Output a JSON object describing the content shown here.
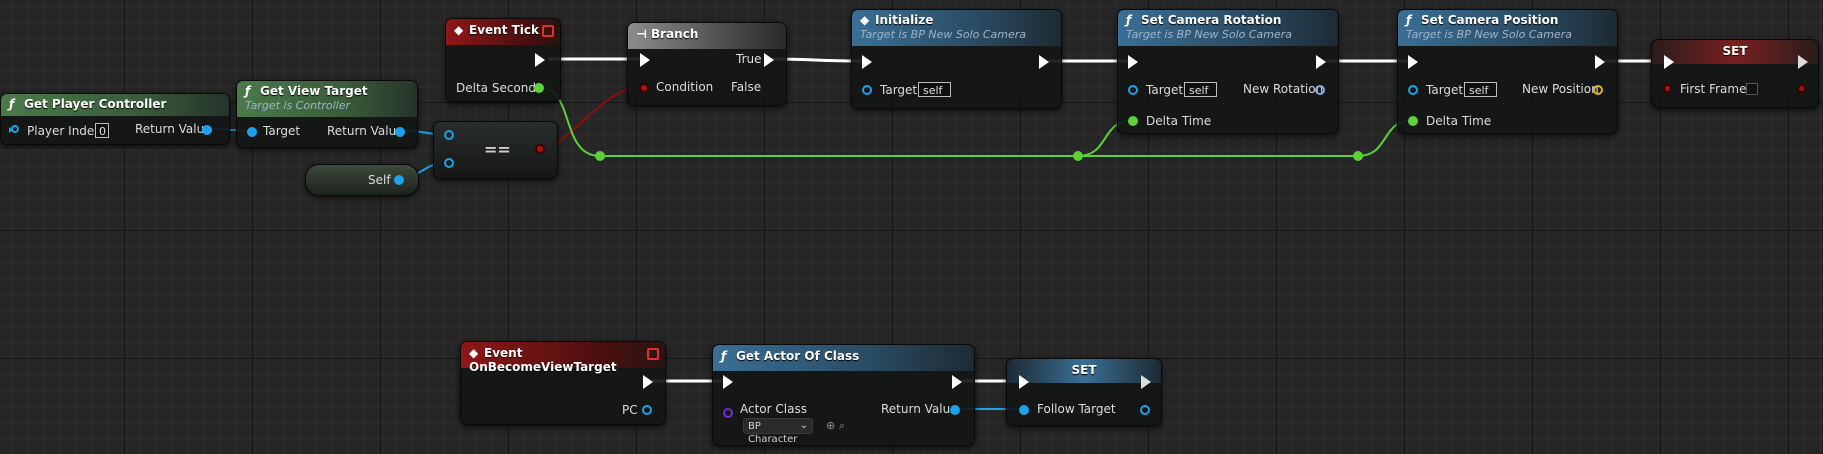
{
  "nodes": {
    "get_player_controller": {
      "title": "Get Player Controller",
      "player_index_label": "Player Index",
      "player_index_value": "0",
      "return_label": "Return Value"
    },
    "get_view_target": {
      "title": "Get View Target",
      "subtitle": "Target is Controller",
      "target_label": "Target",
      "return_label": "Return Value"
    },
    "self_node": {
      "label": "Self"
    },
    "equal_node": {
      "symbol": "=="
    },
    "event_tick": {
      "title": "Event Tick",
      "delta_label": "Delta Seconds"
    },
    "branch": {
      "title": "Branch",
      "true_label": "True",
      "false_label": "False",
      "condition_label": "Condition"
    },
    "initialize": {
      "title": "Initialize",
      "subtitle": "Target is BP New Solo Camera",
      "target_label": "Target",
      "target_value": "self"
    },
    "set_camera_rotation": {
      "title": "Set Camera Rotation",
      "subtitle": "Target is BP New Solo Camera",
      "target_label": "Target",
      "target_value": "self",
      "new_label": "New Rotation",
      "delta_label": "Delta Time"
    },
    "set_camera_position": {
      "title": "Set Camera Position",
      "subtitle": "Target is BP New Solo Camera",
      "target_label": "Target",
      "target_value": "self",
      "new_label": "New Position",
      "delta_label": "Delta Time"
    },
    "set_first_frame": {
      "title": "SET",
      "var_label": "First Frame"
    },
    "event_on_become_view_target": {
      "title": "Event OnBecomeViewTarget",
      "pc_label": "PC"
    },
    "get_actor_of_class": {
      "title": "Get Actor Of Class",
      "class_label": "Actor Class",
      "class_value": "BP Character",
      "return_label": "Return Value"
    },
    "set_follow_target": {
      "title": "SET",
      "var_label": "Follow Target"
    }
  },
  "icons": {
    "function": "function-icon",
    "event": "event-icon",
    "branch": "branch-icon"
  },
  "colors": {
    "exec": "#ffffff",
    "object_pin": "#1da2e8",
    "float_pin": "#5ed138",
    "bool_pin": "#b01010",
    "vector_pin": "#e0b21a",
    "class_pin": "#6b2fd6",
    "event_header": "#8f1717",
    "function_header": "#3a6f96",
    "pure_header": "#4a7a4a"
  }
}
